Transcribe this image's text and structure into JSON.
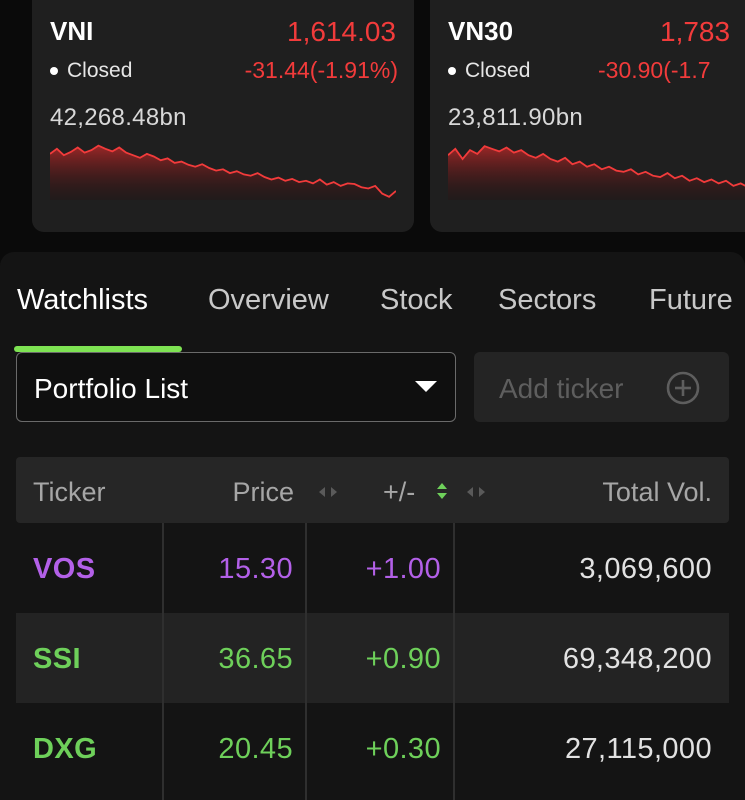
{
  "indices": [
    {
      "name": "VNI",
      "price": "1,614.03",
      "status": "Closed",
      "change": "-31.44(-1.91%)",
      "volume": "42,268.48bn",
      "spark": [
        0.72,
        0.8,
        0.7,
        0.75,
        0.82,
        0.74,
        0.78,
        0.85,
        0.8,
        0.76,
        0.82,
        0.74,
        0.7,
        0.66,
        0.72,
        0.68,
        0.62,
        0.65,
        0.58,
        0.6,
        0.55,
        0.52,
        0.56,
        0.5,
        0.46,
        0.48,
        0.42,
        0.45,
        0.4,
        0.38,
        0.42,
        0.36,
        0.32,
        0.35,
        0.3,
        0.33,
        0.28,
        0.3,
        0.26,
        0.32,
        0.24,
        0.28,
        0.22,
        0.26,
        0.25,
        0.2,
        0.18,
        0.22,
        0.1,
        0.05,
        0.14
      ]
    },
    {
      "name": "VN30",
      "price": "1,783",
      "status": "Closed",
      "change": "-30.90(-1.7",
      "volume": "23,811.90bn",
      "spark": [
        0.7,
        0.8,
        0.64,
        0.78,
        0.72,
        0.84,
        0.8,
        0.76,
        0.82,
        0.74,
        0.78,
        0.7,
        0.66,
        0.72,
        0.64,
        0.6,
        0.66,
        0.56,
        0.6,
        0.52,
        0.56,
        0.48,
        0.52,
        0.46,
        0.44,
        0.48,
        0.4,
        0.44,
        0.38,
        0.36,
        0.42,
        0.34,
        0.38,
        0.3,
        0.34,
        0.28,
        0.32,
        0.26,
        0.3,
        0.22,
        0.26,
        0.2
      ]
    }
  ],
  "tabs": [
    "Watchlists",
    "Overview",
    "Stock",
    "Sectors",
    "Future"
  ],
  "active_tab": 0,
  "watchlist_select": {
    "value": "Portfolio List"
  },
  "add_ticker": {
    "label": "Add ticker"
  },
  "table": {
    "headers": {
      "ticker": "Ticker",
      "price": "Price",
      "change": "+/-",
      "volume": "Total Vol."
    },
    "rows": [
      {
        "ticker": "VOS",
        "price": "15.30",
        "change": "+1.00",
        "volume": "3,069,600",
        "color": "#b360e8"
      },
      {
        "ticker": "SSI",
        "price": "36.65",
        "change": "+0.90",
        "volume": "69,348,200",
        "color": "#6ed05a"
      },
      {
        "ticker": "DXG",
        "price": "20.45",
        "change": "+0.30",
        "volume": "27,115,000",
        "color": "#6ed05a"
      }
    ]
  },
  "colors": {
    "down": "#f23b3b",
    "accent": "#7ee353"
  }
}
